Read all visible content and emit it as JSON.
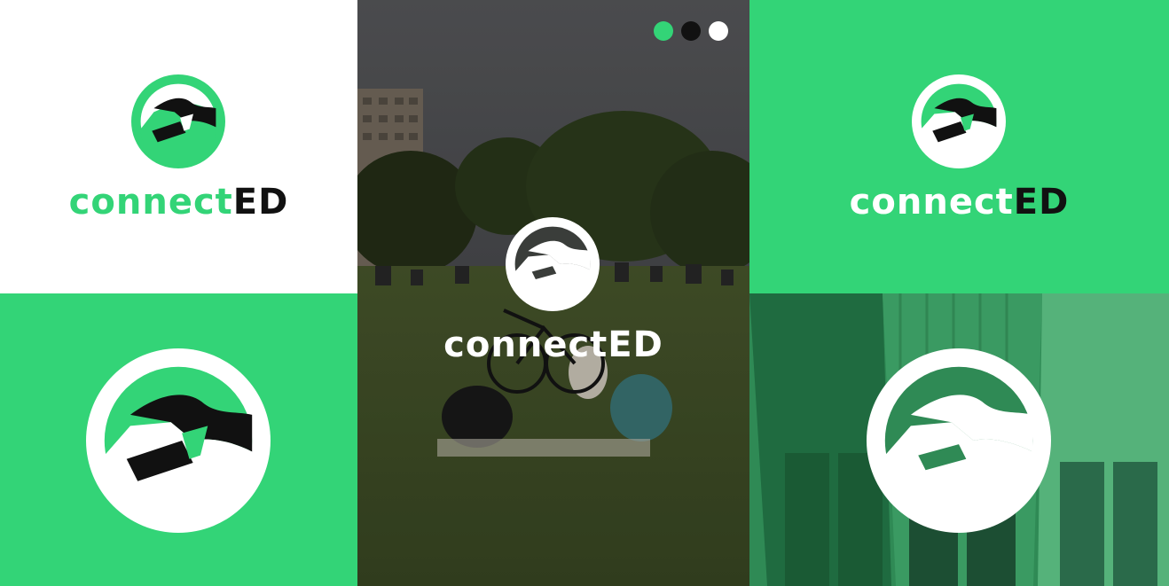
{
  "brand": {
    "name_part1": "connect",
    "name_part2": "ED",
    "colors": {
      "green": "#33d477",
      "black": "#111111",
      "white": "#ffffff"
    }
  },
  "panels": {
    "top_left": {
      "background": "#ffffff",
      "logo": "full-logo-green-on-white"
    },
    "bottom_left": {
      "background": "#33d477",
      "logo": "emblem-white-ring"
    },
    "middle": {
      "background": "park-picnic-photo",
      "logo": "full-logo-white-on-photo"
    },
    "top_right": {
      "background": "#33d477",
      "logo": "full-logo-white-on-green"
    },
    "bottom_right": {
      "background": "green-tinted-people-photo",
      "logo": "emblem-white-ring"
    }
  },
  "color_swatches": [
    "#33d477",
    "#111111",
    "#ffffff"
  ],
  "icons": [
    "handshake-cap-emblem-icon"
  ]
}
